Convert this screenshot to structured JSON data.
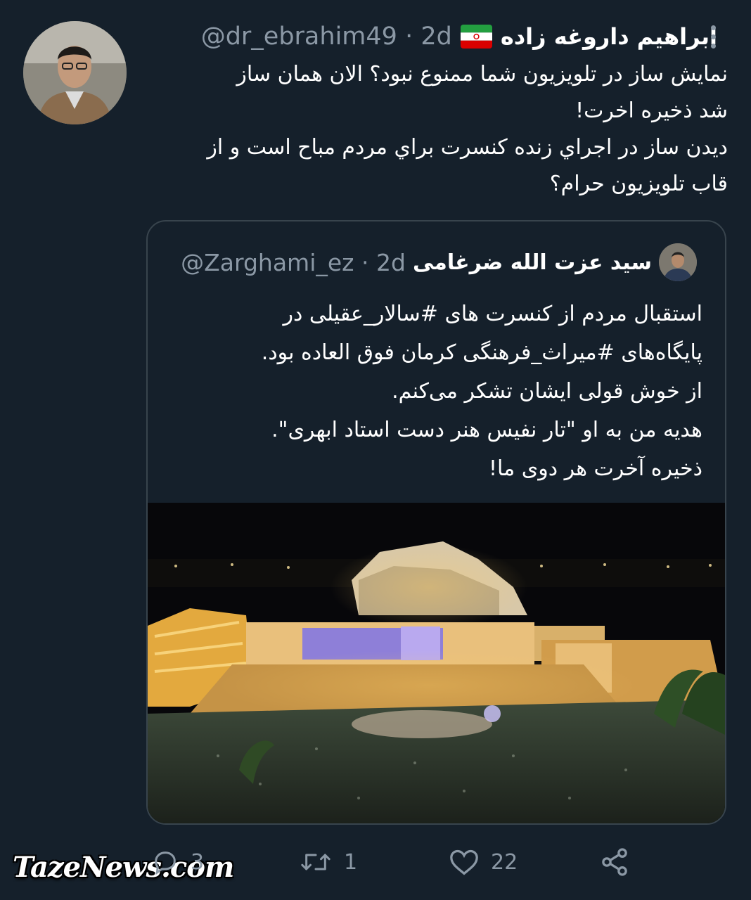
{
  "tweet": {
    "author_name": "ابراهیم داروغه زاده",
    "handle": "@dr_ebrahim49",
    "separator": "·",
    "time": "2d",
    "text": "نمایش ساز در تلویزیون شما  ممنوع نبود؟ الان همان ساز\nشد ذخیره اخرت!\nدیدن ساز در اجراي زنده کنسرت براي مردم مباح است و از\nقاب تلویزیون حرام؟"
  },
  "quoted_tweet": {
    "author_name": "سید عزت الله ضرغامی",
    "handle": "@Zarghami_ez",
    "separator": "·",
    "time": "2d",
    "text": "استقبال مردم از کنسرت های #سالار_عقیلی در\nپایگاه‌های #میراث_فرهنگی کرمان فوق العاده بود.\n از خوش قولی ایشان تشکر می‌کنم.\nهدیه من به او \"تار نفیس هنر دست استاد ابهری\".\nذخیره آخرت هر دوی ما!"
  },
  "actions": {
    "reply_count": "3",
    "retweet_count": "1",
    "like_count": "22"
  },
  "icons": {
    "more": "more-vertical-icon",
    "flag": "iran-flag-icon",
    "reply": "reply-icon",
    "retweet": "retweet-icon",
    "like": "heart-icon",
    "share": "share-icon"
  },
  "colors": {
    "background": "#15202b",
    "secondary_text": "#8b98a5",
    "border": "#38444d"
  },
  "watermark": "TazeNews.com"
}
